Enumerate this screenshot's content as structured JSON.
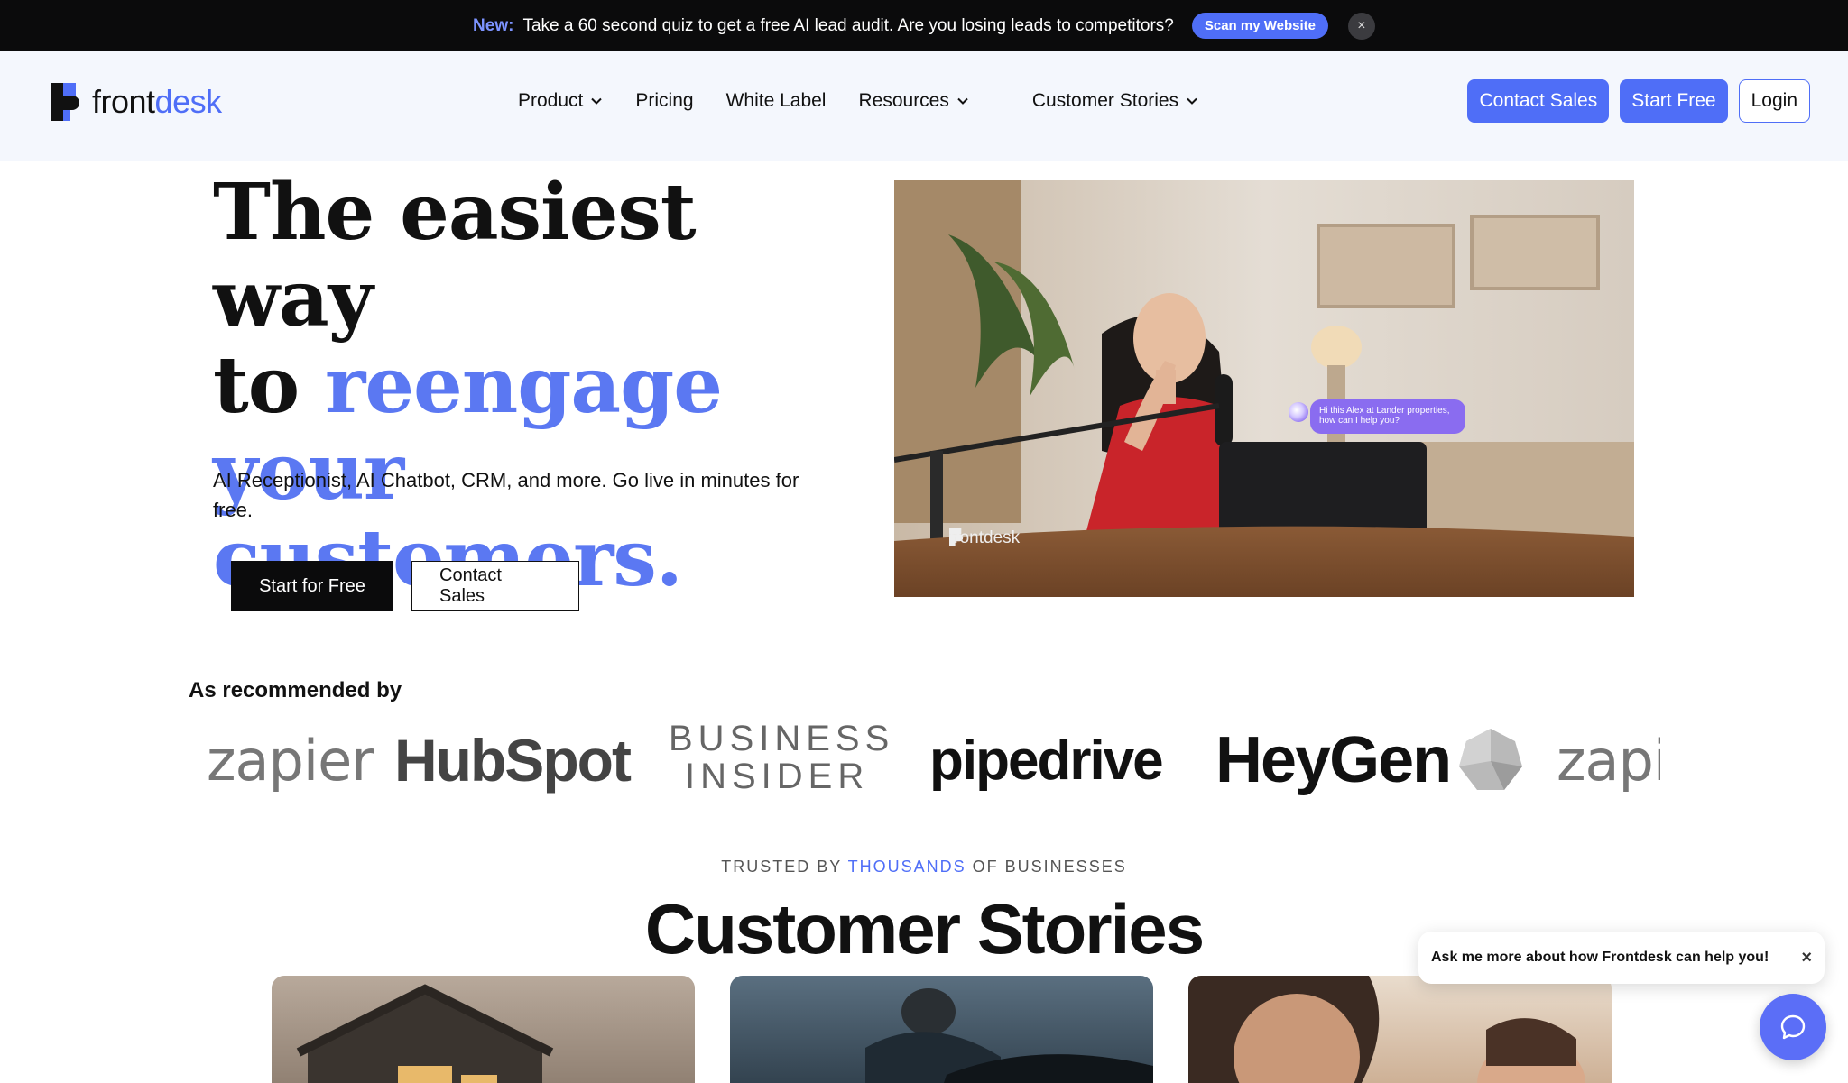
{
  "announcement": {
    "new_label": "New:",
    "text": "Take a 60 second quiz to get a free AI lead audit. Are you losing leads to competitors?",
    "button": "Scan my Website",
    "close": "×"
  },
  "nav": {
    "logo_front": "front",
    "logo_desk": "desk",
    "links": [
      {
        "label": "Product",
        "dropdown": true
      },
      {
        "label": "Pricing",
        "dropdown": false
      },
      {
        "label": "White Label",
        "dropdown": false
      },
      {
        "label": "Resources",
        "dropdown": true
      },
      {
        "label": "Customer Stories",
        "dropdown": true
      }
    ],
    "contact_sales": "Contact Sales",
    "start_free": "Start Free",
    "login": "Login"
  },
  "hero": {
    "title_line1": "The easiest way",
    "title_to": "to ",
    "title_accent": "reengage your customers.",
    "subtitle": "AI Receptionist, AI Chatbot, CRM, and more. Go live in minutes for free.",
    "cta_primary": "Start for Free",
    "cta_secondary": "Contact Sales",
    "video_bubble": "Hi this Alex at Lander properties, how can I help you?",
    "video_logo": "frontdesk"
  },
  "recommended": {
    "label": "As recommended by",
    "brands": [
      "zapier",
      "HubSpot",
      "BUSINESS",
      "INSIDER",
      "pipedrive",
      "HeyGen",
      "zapi"
    ]
  },
  "stories": {
    "trusted_pre": "TRUSTED BY ",
    "trusted_hl": "THOUSANDS",
    "trusted_post": " OF BUSINESSES",
    "title": "Customer Stories"
  },
  "chat": {
    "prompt": "Ask me more about how Frontdesk can help you!",
    "close": "×"
  },
  "colors": {
    "accent": "#4f6ef7",
    "announce_bg": "#0b0b0c",
    "nav_bg": "#f4f7fd"
  }
}
